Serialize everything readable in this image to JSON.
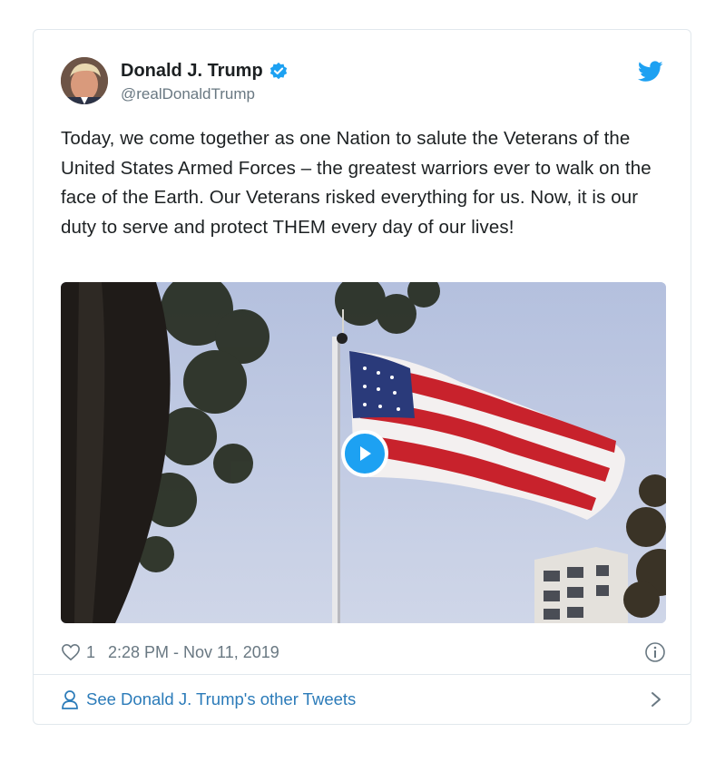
{
  "tweet": {
    "author_name": "Donald J. Trump",
    "handle": "@realDonaldTrump",
    "text": "Today, we come together as one Nation to salute the Veterans of the United States Armed Forces – the greatest warriors ever to walk on the face of the Earth. Our Veterans risked everything for us. Now, it is our duty to serve and protect THEM every day of our lives!",
    "like_count": "1",
    "timestamp": "2:28 PM - Nov 11, 2019"
  },
  "footer": {
    "other_tweets_label": "See Donald J. Trump's other Tweets"
  },
  "icons": {
    "verified": "verified-badge-icon",
    "brand": "twitter-bird-icon",
    "play": "play-icon",
    "like": "heart-icon",
    "info": "info-icon",
    "profile": "person-icon",
    "chevron": "chevron-right-icon"
  },
  "colors": {
    "twitter_blue": "#1da1f2",
    "link": "#2b7bb9",
    "muted": "#697882",
    "border": "#e1e8ed"
  }
}
